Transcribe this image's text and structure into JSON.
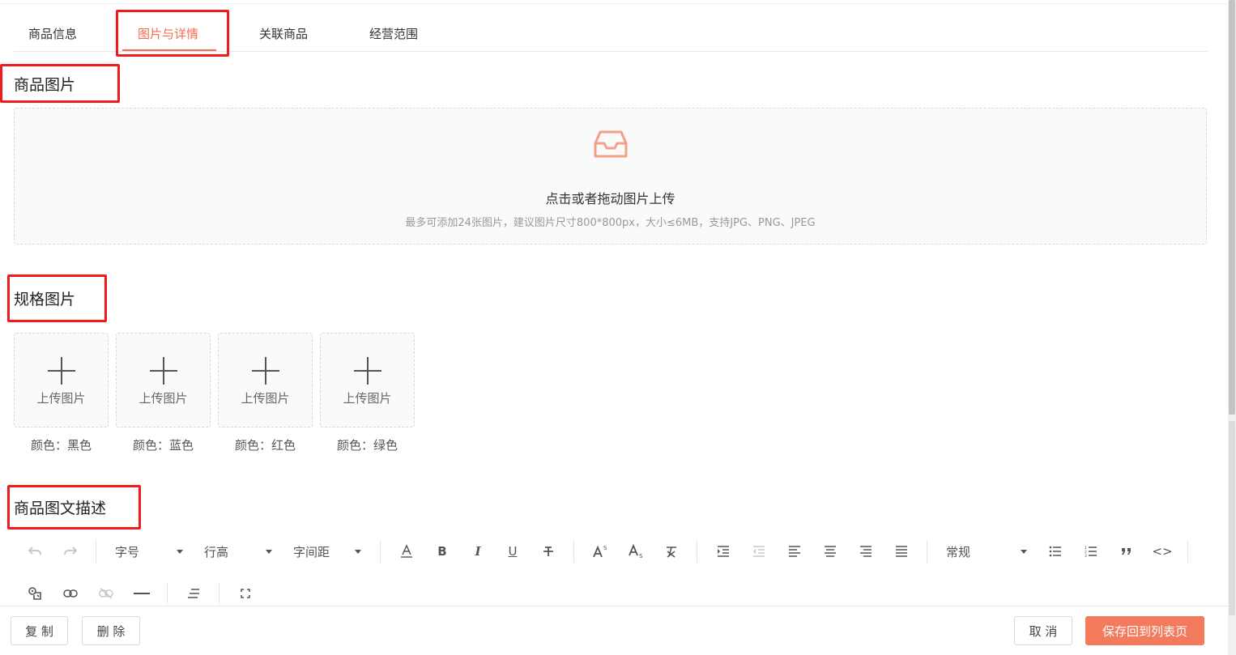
{
  "tabs": [
    {
      "label": "商品信息",
      "active": false
    },
    {
      "label": "图片与详情",
      "active": true
    },
    {
      "label": "关联商品",
      "active": false
    },
    {
      "label": "经营范围",
      "active": false
    }
  ],
  "sections": {
    "product_images": "商品图片",
    "spec_images": "规格图片",
    "description": "商品图文描述"
  },
  "upload": {
    "icon": "inbox-icon",
    "text": "点击或者拖动图片上传",
    "hint": "最多可添加24张图片，建议图片尺寸800*800px，大小≤6MB，支持JPG、PNG、JPEG"
  },
  "spec_slots": [
    {
      "label": "上传图片",
      "caption": "颜色：黑色"
    },
    {
      "label": "上传图片",
      "caption": "颜色：蓝色"
    },
    {
      "label": "上传图片",
      "caption": "颜色：红色"
    },
    {
      "label": "上传图片",
      "caption": "颜色：绿色"
    }
  ],
  "toolbar": {
    "font_size": "字号",
    "line_height": "行高",
    "letter_spacing": "字间距",
    "heading": "常规",
    "bold": "B",
    "italic": "I",
    "underline": "U",
    "code": "<>"
  },
  "footer": {
    "copy": "复 制",
    "delete": "删 除",
    "cancel": "取 消",
    "save": "保存回到列表页"
  },
  "colors": {
    "accent": "#f26c4f",
    "primary_button": "#f47a5e",
    "highlight_box": "#ee1c1c"
  }
}
